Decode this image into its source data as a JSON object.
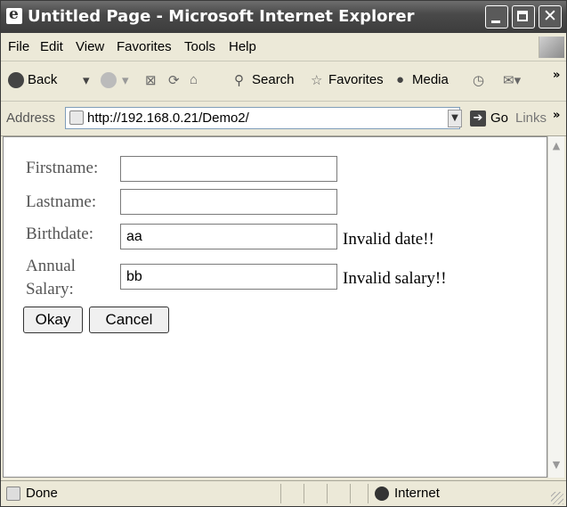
{
  "window": {
    "title": "Untitled Page - Microsoft Internet Explorer"
  },
  "menu": {
    "items": [
      "File",
      "Edit",
      "View",
      "Favorites",
      "Tools",
      "Help"
    ]
  },
  "toolbar": {
    "back_label": "Back",
    "search_label": "Search",
    "favorites_label": "Favorites",
    "media_label": "Media"
  },
  "address": {
    "label": "Address",
    "url": "http://192.168.0.21/Demo2/",
    "go_label": "Go",
    "links_label": "Links"
  },
  "form": {
    "firstname_label": "Firstname:",
    "firstname_value": "",
    "lastname_label": "Lastname:",
    "lastname_value": "",
    "birthdate_label": "Birthdate:",
    "birthdate_value": "aa",
    "birthdate_error": "Invalid date!!",
    "salary_label_line1": "Annual",
    "salary_label_line2": "Salary:",
    "salary_value": "bb",
    "salary_error": "Invalid salary!!",
    "okay_label": "Okay",
    "cancel_label": "Cancel"
  },
  "status": {
    "text": "Done",
    "zone": "Internet"
  },
  "icons": {
    "page_icon": "ie-page-icon",
    "window_controls": [
      "minimize-icon",
      "maximize-icon",
      "close-icon"
    ]
  }
}
